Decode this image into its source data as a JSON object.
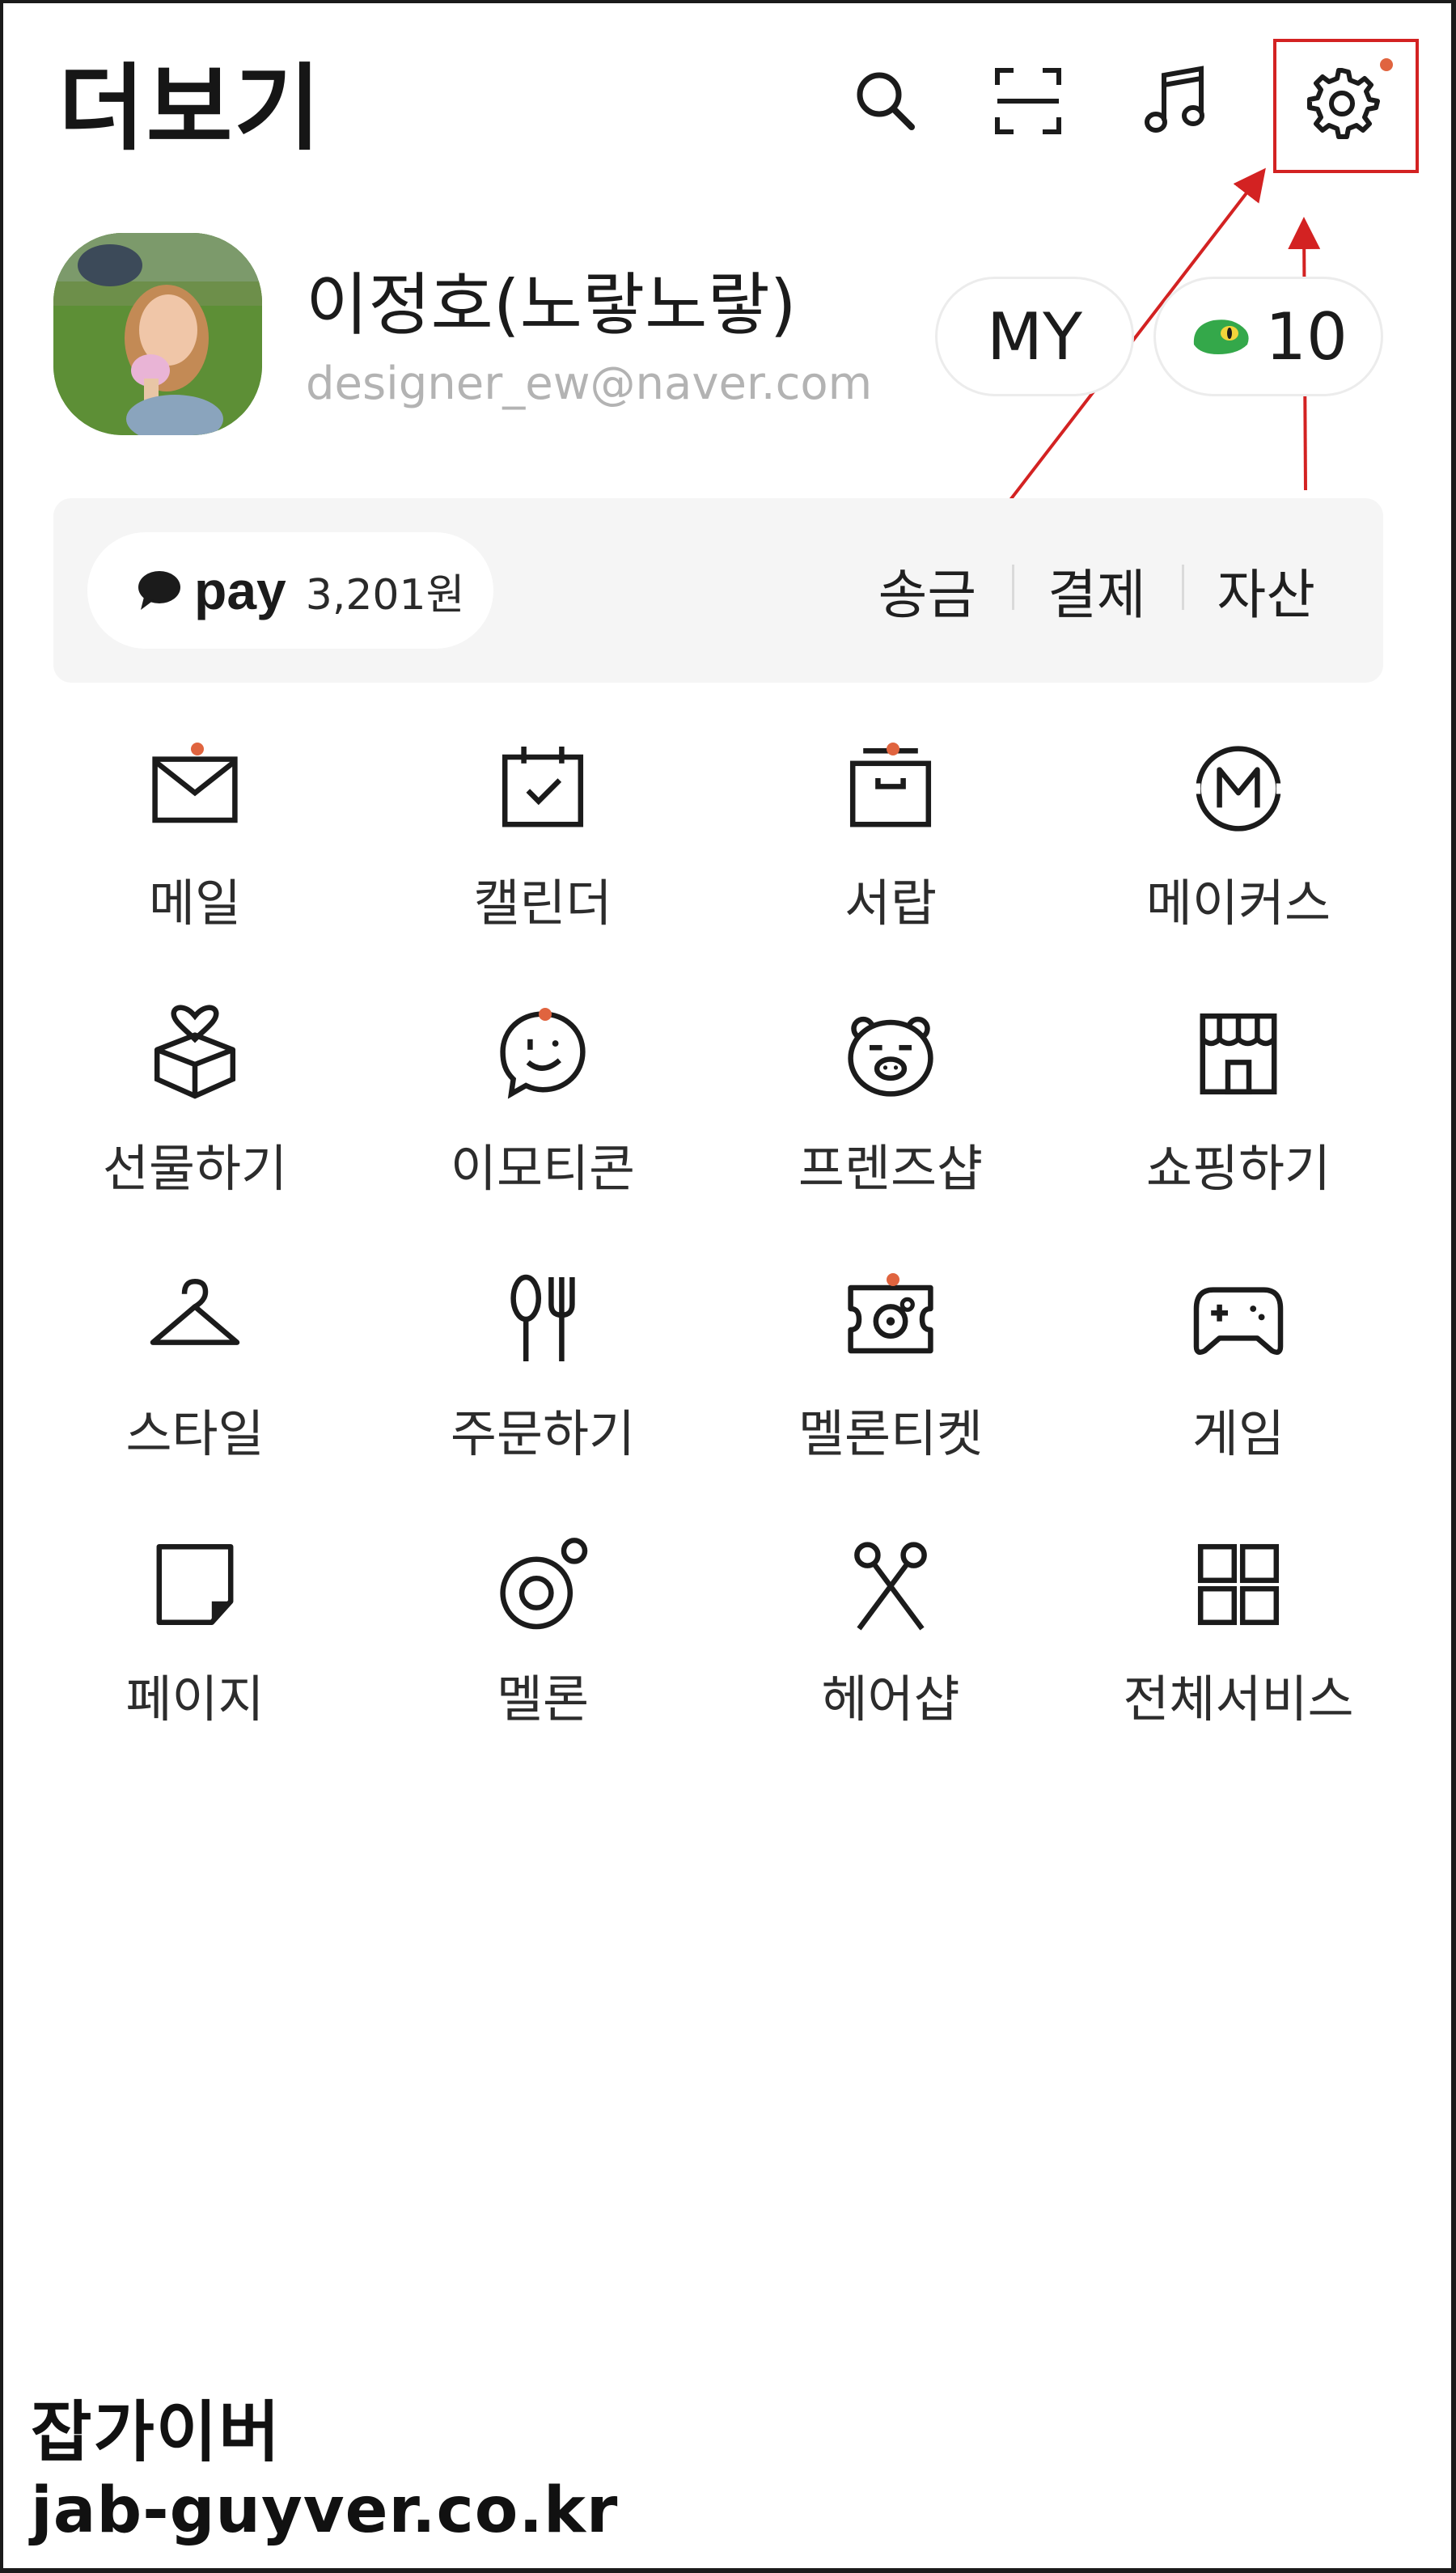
{
  "header": {
    "title": "더보기"
  },
  "top_icons": [
    {
      "name": "search-icon"
    },
    {
      "name": "qr-scan-icon"
    },
    {
      "name": "music-icon"
    },
    {
      "name": "settings-icon",
      "has_badge": true
    }
  ],
  "profile": {
    "name": "이정호(노랗노랗)",
    "email": "designer_ew@naver.com",
    "my_button": "MY",
    "coin_count": "10"
  },
  "pay": {
    "logo": "pay",
    "amount": "3,201원",
    "actions": [
      "송금",
      "결제",
      "자산"
    ]
  },
  "services": [
    {
      "label": "메일",
      "icon": "mail-icon",
      "badge": true
    },
    {
      "label": "캘린더",
      "icon": "calendar-icon",
      "badge": false
    },
    {
      "label": "서랍",
      "icon": "drawer-icon",
      "badge": true
    },
    {
      "label": "메이커스",
      "icon": "makers-icon",
      "badge": false
    },
    {
      "label": "선물하기",
      "icon": "gift-icon",
      "badge": false
    },
    {
      "label": "이모티콘",
      "icon": "emoticon-icon",
      "badge": true
    },
    {
      "label": "프렌즈샵",
      "icon": "friends-bear-icon",
      "badge": false
    },
    {
      "label": "쇼핑하기",
      "icon": "shop-icon",
      "badge": false
    },
    {
      "label": "스타일",
      "icon": "hanger-icon",
      "badge": false
    },
    {
      "label": "주문하기",
      "icon": "utensils-icon",
      "badge": false
    },
    {
      "label": "멜론티켓",
      "icon": "ticket-icon",
      "badge": true
    },
    {
      "label": "게임",
      "icon": "gamepad-icon",
      "badge": false
    },
    {
      "label": "페이지",
      "icon": "page-icon",
      "badge": false
    },
    {
      "label": "멜론",
      "icon": "melon-icon",
      "badge": false
    },
    {
      "label": "헤어샵",
      "icon": "scissors-icon",
      "badge": false
    },
    {
      "label": "전체서비스",
      "icon": "all-services-icon",
      "badge": false
    }
  ],
  "watermark": {
    "line1": "잡가이버",
    "line2": "jab-guyver.co.kr"
  },
  "colors": {
    "badge": "#e0643f",
    "annotation": "#d32222",
    "coin": "#34a84a",
    "pay_bg": "#f5f5f5"
  }
}
